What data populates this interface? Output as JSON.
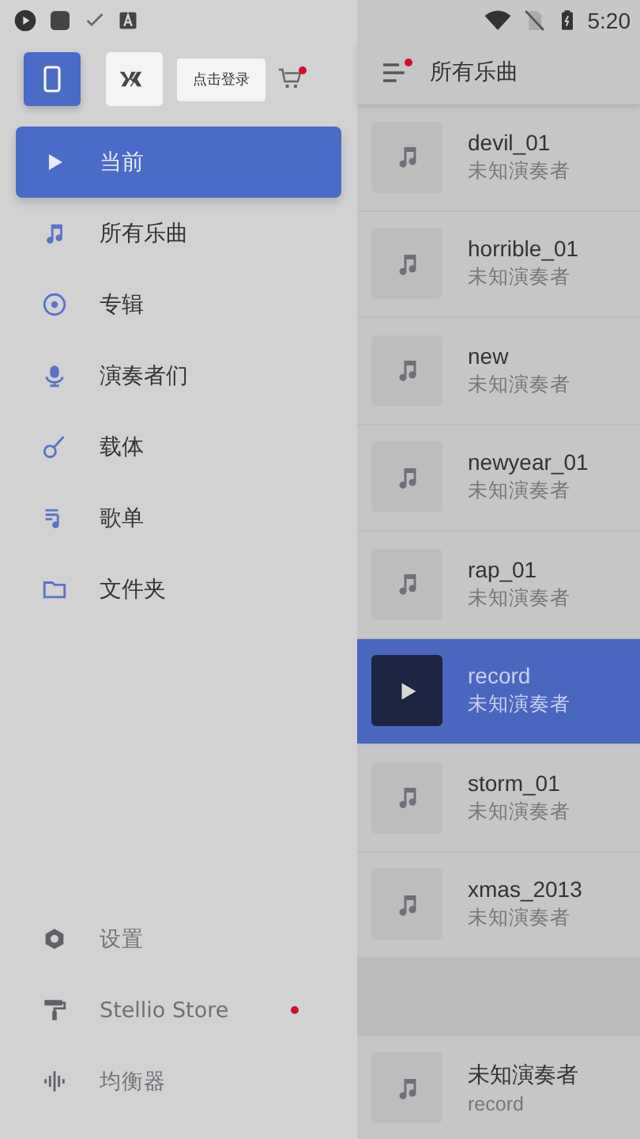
{
  "status_bar": {
    "time": "5:20"
  },
  "drawer": {
    "login_tooltip": "点击登录",
    "cart_badge": true,
    "items": [
      {
        "label": "当前",
        "selected": true
      },
      {
        "label": "所有乐曲",
        "selected": false
      },
      {
        "label": "专辑",
        "selected": false
      },
      {
        "label": "演奏者们",
        "selected": false
      },
      {
        "label": "载体",
        "selected": false
      },
      {
        "label": "歌单",
        "selected": false
      },
      {
        "label": "文件夹",
        "selected": false
      }
    ],
    "footer_items": [
      {
        "label": "设置",
        "badge": false
      },
      {
        "label": "Stellio Store",
        "badge": true
      },
      {
        "label": "均衡器",
        "badge": false
      }
    ]
  },
  "header": {
    "title": "所有乐曲",
    "menu_badge": true
  },
  "tracks": [
    {
      "title": "devil_01",
      "artist": "未知演奏者",
      "selected": false
    },
    {
      "title": "horrible_01",
      "artist": "未知演奏者",
      "selected": false
    },
    {
      "title": "new",
      "artist": "未知演奏者",
      "selected": false
    },
    {
      "title": "newyear_01",
      "artist": "未知演奏者",
      "selected": false
    },
    {
      "title": "rap_01",
      "artist": "未知演奏者",
      "selected": false
    },
    {
      "title": "record",
      "artist": "未知演奏者",
      "selected": true
    },
    {
      "title": "storm_01",
      "artist": "未知演奏者",
      "selected": false
    },
    {
      "title": "xmas_2013",
      "artist": "未知演奏者",
      "selected": false
    }
  ],
  "mini_player": {
    "title": "未知演奏者",
    "subtitle": "record"
  }
}
